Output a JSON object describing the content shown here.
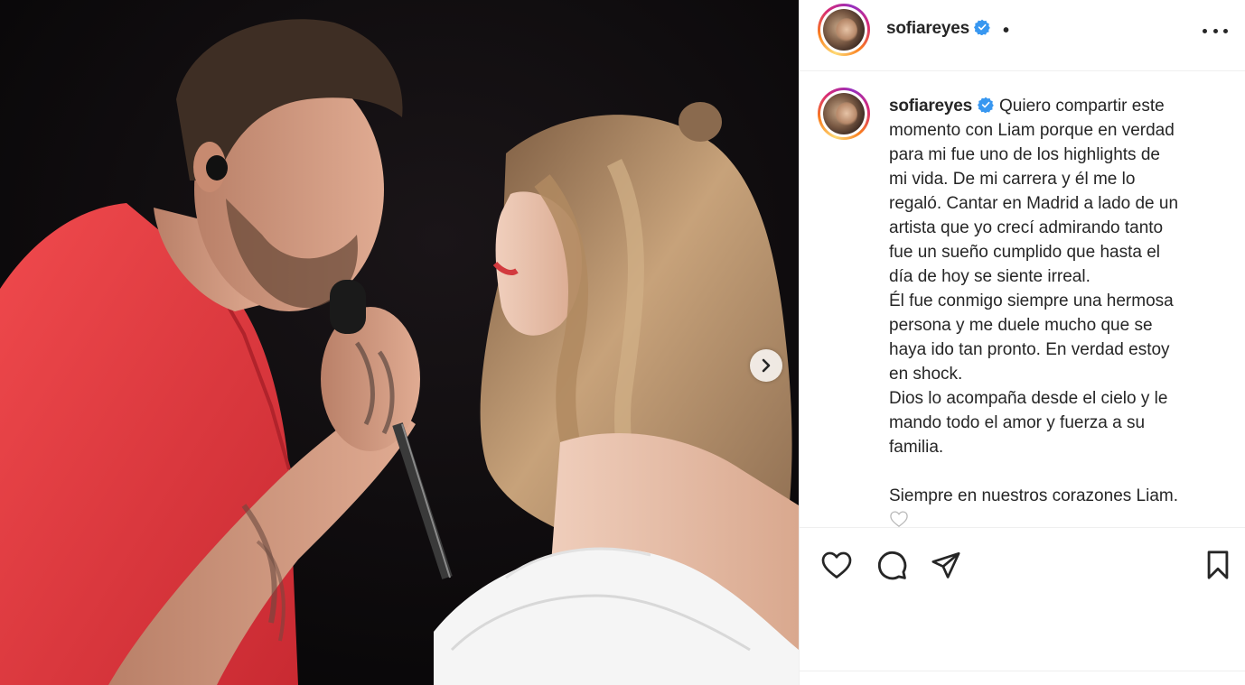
{
  "post": {
    "username": "sofiareyes",
    "separator": "•",
    "caption_lines": [
      "Quiero compartir este",
      "momento con Liam porque en verdad",
      "para mi fue uno de los highlights de",
      "mi vida. De mi carrera y él me lo",
      "regaló. Cantar en Madrid a lado de un",
      "artista que yo crecí admirando tanto",
      "fue un sueño cumplido que hasta el",
      "día de hoy se siente irreal.",
      "Él fue conmigo siempre una hermosa",
      "persona y me duele mucho que se",
      "haya ido tan pronto. En verdad estoy",
      "en shock.",
      "Dios lo acompaña desde el cielo y le",
      "mando todo el amor y fuerza a su",
      "familia.",
      "",
      "Siempre en nuestros corazones Liam."
    ]
  },
  "icons": {
    "verified": "verified-badge-icon",
    "more": "more-options-icon",
    "next": "chevron-right-icon",
    "like": "heart-icon",
    "comment": "comment-icon",
    "share": "share-icon",
    "save": "bookmark-icon",
    "emoji": "white-heart-emoji"
  },
  "colors": {
    "verified_blue": "#3897f0",
    "text": "#262626",
    "divider": "#efefef",
    "shirt_red": "#e0383c"
  }
}
